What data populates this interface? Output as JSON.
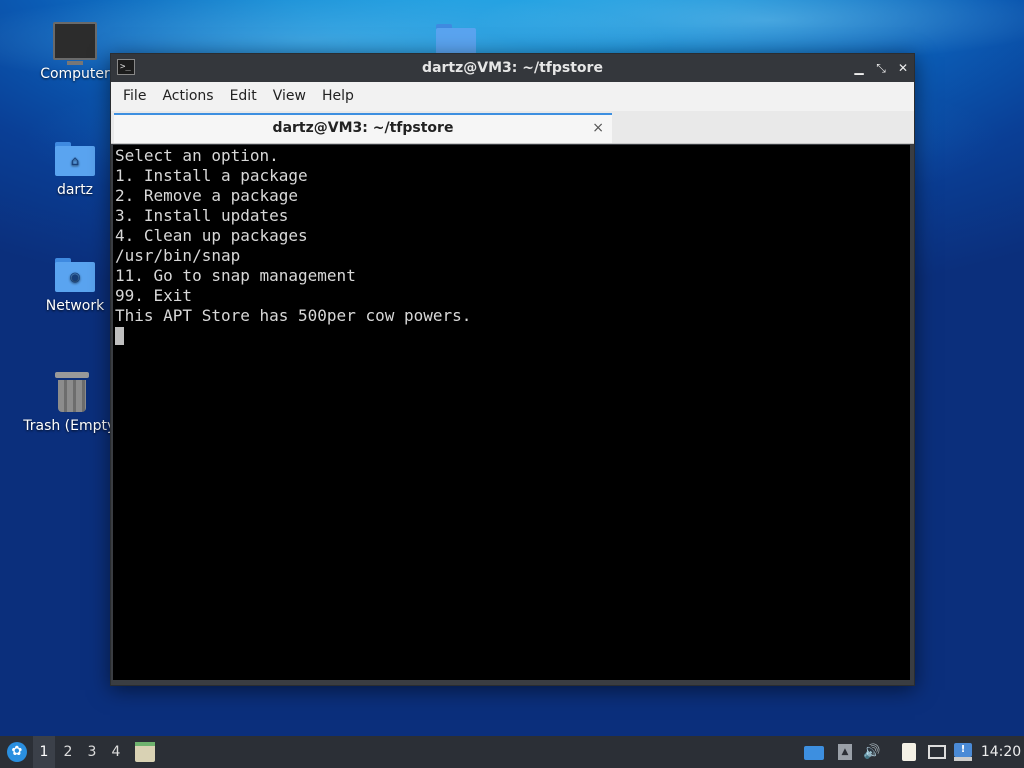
{
  "desktop": {
    "icons": [
      {
        "label": "Computer"
      },
      {
        "label": "dartz"
      },
      {
        "label": "Network"
      },
      {
        "label": "Trash (Empty)"
      }
    ]
  },
  "window": {
    "title": "dartz@VM3: ~/tfpstore",
    "menu": [
      "File",
      "Actions",
      "Edit",
      "View",
      "Help"
    ],
    "tab_title": "dartz@VM3: ~/tfpstore",
    "tab_close": "×"
  },
  "terminal": {
    "lines": [
      "Select an option.",
      "1. Install a package",
      "2. Remove a package",
      "3. Install updates",
      "4. Clean up packages",
      "/usr/bin/snap",
      "11. Go to snap management",
      "99. Exit",
      "This APT Store has 500per cow powers."
    ]
  },
  "taskbar": {
    "workspaces": [
      "1",
      "2",
      "3",
      "4"
    ],
    "active_workspace": "1",
    "clock": "14:20"
  },
  "colors": {
    "accent": "#3d8fe0",
    "terminal_bg": "#000000",
    "terminal_fg": "#d8d8d8"
  }
}
